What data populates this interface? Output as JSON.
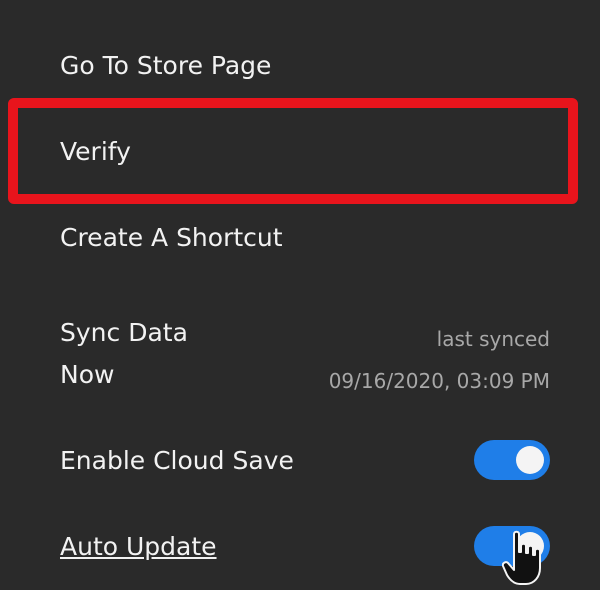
{
  "menu": {
    "items": [
      {
        "label": "Go To Store Page"
      },
      {
        "label": "Verify"
      },
      {
        "label": "Create A Shortcut"
      }
    ],
    "sync": {
      "label": "Sync Data Now",
      "meta_label": "last synced",
      "meta_time": "09/16/2020, 03:09 PM"
    },
    "toggles": [
      {
        "label": "Enable Cloud Save",
        "on": true
      },
      {
        "label": "Auto Update",
        "on": true
      }
    ]
  },
  "colors": {
    "background": "#2a2a2a",
    "text": "#f2f2f2",
    "muted_text": "#a8a8a8",
    "toggle_on": "#1f7ee8",
    "highlight": "#e8141c"
  },
  "icons": {
    "cursor": "hand-pointer-icon"
  }
}
